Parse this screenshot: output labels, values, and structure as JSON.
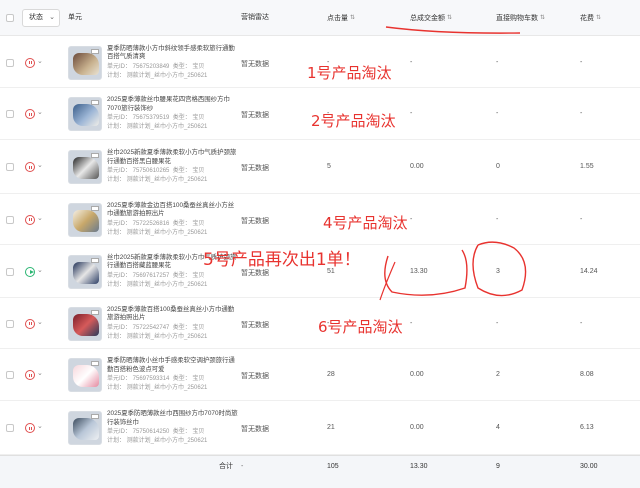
{
  "header": {
    "status_label": "状态",
    "unit_label": "单元",
    "radar_label": "营销雷达",
    "clicks_label": "点击量",
    "gmv_label": "总成交金额",
    "cart_label": "直接购物车数",
    "cost_label": "花费",
    "sort_glyph": "⇅"
  },
  "rows": [
    {
      "title": "夏季防晒薄款小方巾斜纹领手感柔软旅行通勤百搭气质清爽",
      "unit_id": "单元ID： 75675203849",
      "type": "类型： 宝贝",
      "plan": "计划： 测款计划_丝巾小方巾_250621",
      "radar": "暂无数据",
      "clicks": "-",
      "gmv": "-",
      "cart": "-",
      "cost": "-",
      "status": "paused"
    },
    {
      "title": "2025夏季薄款丝巾腰果花四宫格西围纱方巾7070旅行装饰纱",
      "unit_id": "单元ID： 75675379519",
      "type": "类型： 宝贝",
      "plan": "计划： 测款计划_丝巾小方巾_250621",
      "radar": "暂无数据",
      "clicks": "-",
      "gmv": "-",
      "cart": "-",
      "cost": "-",
      "status": "paused"
    },
    {
      "title": "丝巾2025新款夏季薄款柔软小方巾气质护颈旅行通勤百搭黑白腰果花",
      "unit_id": "单元ID： 75750610265",
      "type": "类型： 宝贝",
      "plan": "计划： 测款计划_丝巾小方巾_250621",
      "radar": "暂无数据",
      "clicks": "5",
      "gmv": "0.00",
      "cart": "0",
      "cost": "1.55",
      "status": "paused"
    },
    {
      "title": "2025夏季薄款金边百搭100桑蚕丝真丝小方丝巾通勤旅游拍照出片",
      "unit_id": "单元ID： 75722526816",
      "type": "类型： 宝贝",
      "plan": "计划： 测款计划_丝巾小方巾_250621",
      "radar": "暂无数据",
      "clicks": "-",
      "gmv": "-",
      "cart": "-",
      "cost": "-",
      "status": "paused"
    },
    {
      "title": "丝巾2025新款夏季薄款柔软小方巾气质护颈旅行通勤百搭藏蓝腰果花",
      "unit_id": "单元ID： 75697617257",
      "type": "类型： 宝贝",
      "plan": "计划： 测款计划_丝巾小方巾_250621",
      "radar": "暂无数据",
      "clicks": "51",
      "gmv": "13.30",
      "cart": "3",
      "cost": "14.24",
      "status": "active"
    },
    {
      "title": "2025夏季薄款百搭100桑蚕丝真丝小方巾通勤旅游拍照出片",
      "unit_id": "单元ID： 75722542747",
      "type": "类型： 宝贝",
      "plan": "计划： 测款计划_丝巾小方巾_250621",
      "radar": "暂无数据",
      "clicks": "-",
      "gmv": "-",
      "cart": "-",
      "cost": "-",
      "status": "paused"
    },
    {
      "title": "夏季防晒薄款小丝巾手感柔软空调护颈旅行通勤百搭粉色波点可爱",
      "unit_id": "单元ID： 75697593314",
      "type": "类型： 宝贝",
      "plan": "计划： 测款计划_丝巾小方巾_250621",
      "radar": "暂无数据",
      "clicks": "28",
      "gmv": "0.00",
      "cart": "2",
      "cost": "8.08",
      "status": "paused"
    },
    {
      "title": "2025夏季防晒薄款丝巾西围纱方巾7070时尚旅行装饰丝巾",
      "unit_id": "单元ID： 75750614250",
      "type": "类型： 宝贝",
      "plan": "计划： 测款计划_丝巾小方巾_250621",
      "radar": "暂无数据",
      "clicks": "21",
      "gmv": "0.00",
      "cart": "4",
      "cost": "6.13",
      "status": "paused"
    }
  ],
  "footer": {
    "label": "合计",
    "radar": "-",
    "clicks": "105",
    "gmv": "13.30",
    "cart": "9",
    "cost": "30.00"
  },
  "annotations": {
    "a1": "1号产品淘汰",
    "a2": "2号产品淘汰",
    "a4": "4号产品淘汰",
    "a5": "5号产品再次出1单！",
    "a6": "6号产品淘汰"
  },
  "colors": {
    "annotation": "#e8332f",
    "pause": "#e05050",
    "active": "#2bb673"
  },
  "icons": {
    "status_chevron": "chevron-down-icon",
    "pause": "pause-circle-icon",
    "play": "play-circle-icon"
  }
}
